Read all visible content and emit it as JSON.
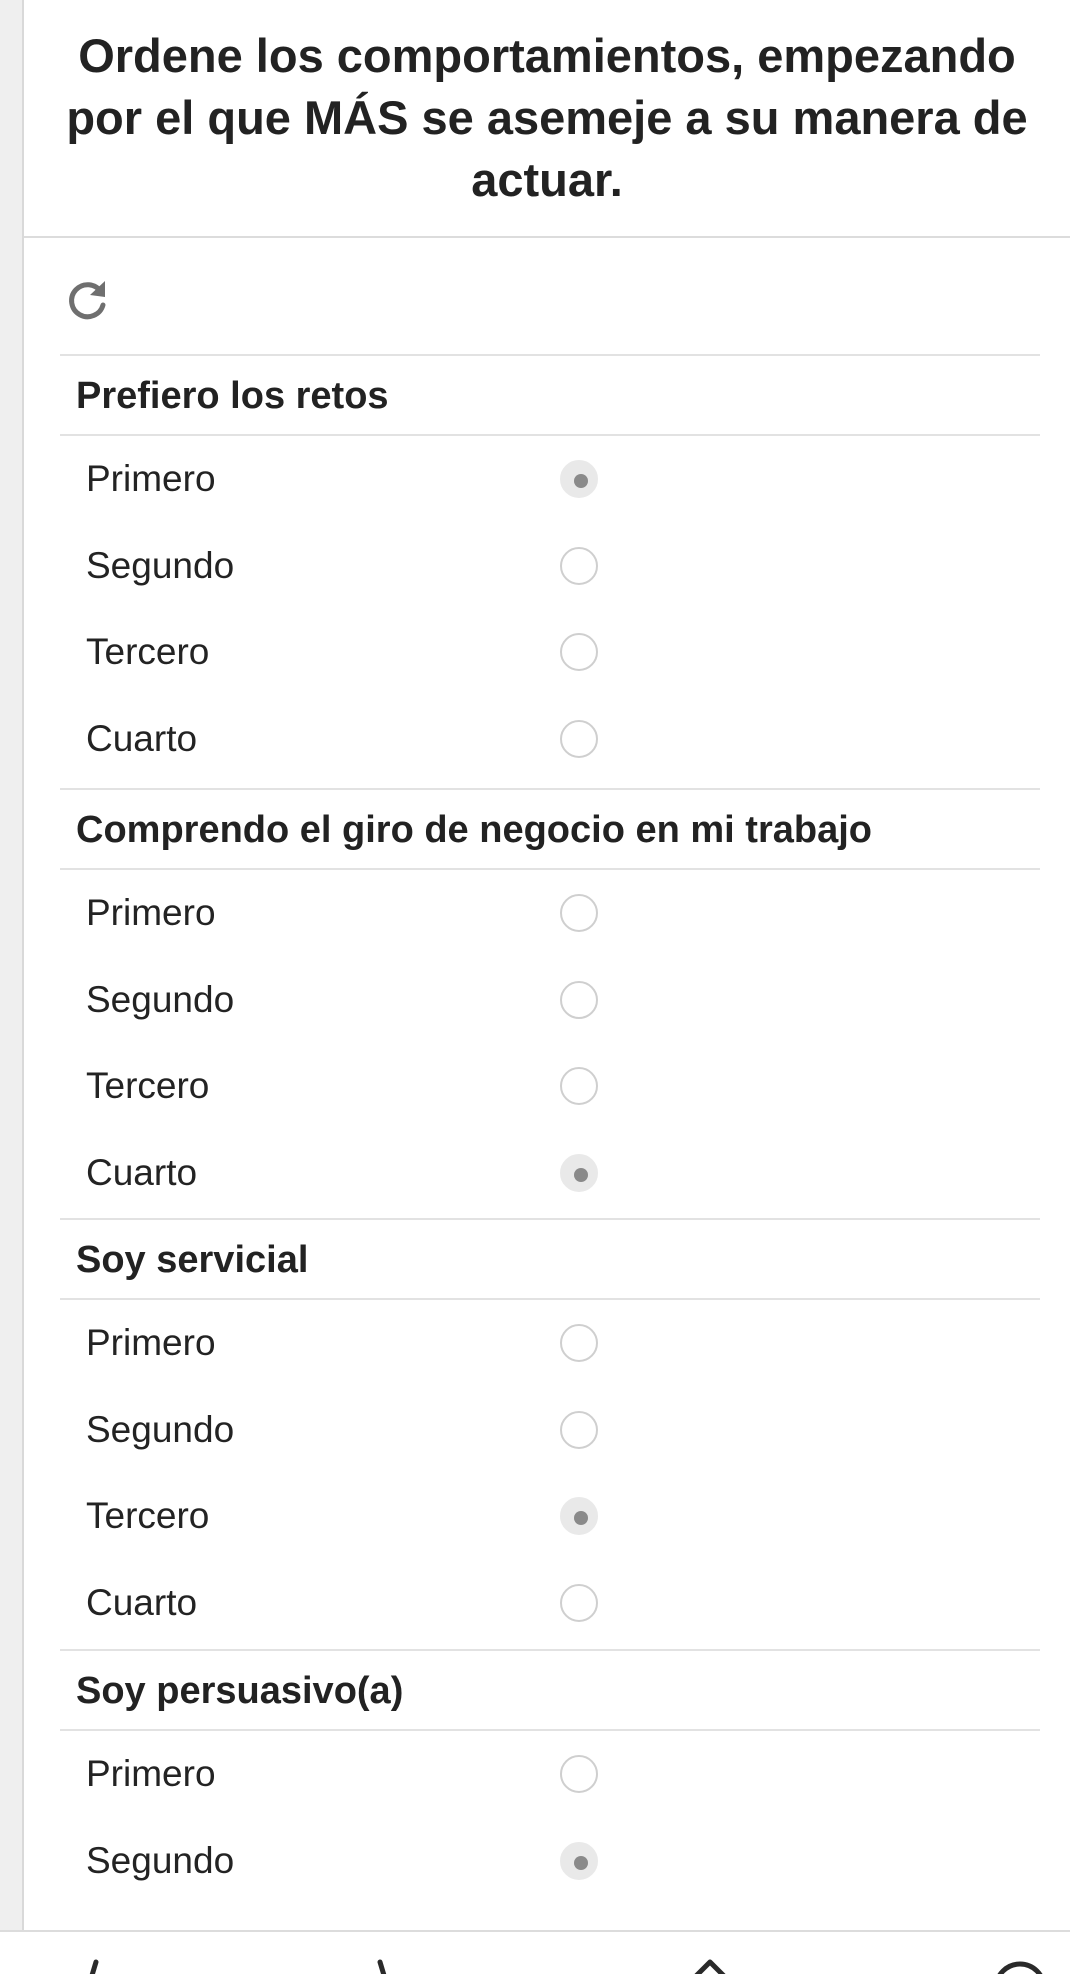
{
  "header": {
    "title": "Ordene los comportamientos, empezando por el que MÁS se asemeje a su manera de actuar."
  },
  "toolbar": {
    "refresh_icon": "refresh-icon"
  },
  "questions": [
    {
      "label": "Prefiero los retos",
      "options": [
        "Primero",
        "Segundo",
        "Tercero",
        "Cuarto"
      ],
      "selected": "Primero"
    },
    {
      "label": "Comprendo el giro de negocio en mi trabajo",
      "options": [
        "Primero",
        "Segundo",
        "Tercero",
        "Cuarto"
      ],
      "selected": "Cuarto"
    },
    {
      "label": "Soy servicial",
      "options": [
        "Primero",
        "Segundo",
        "Tercero",
        "Cuarto"
      ],
      "selected": "Tercero"
    },
    {
      "label": "Soy persuasivo(a)",
      "options": [
        "Primero",
        "Segundo"
      ],
      "selected": "Segundo"
    }
  ],
  "nav_icons": [
    "back-icon",
    "forward-icon",
    "up-icon",
    "circle-icon"
  ],
  "colors": {
    "radio_border": "#cfcfcf",
    "radio_checked_bg": "#e9e9e9",
    "radio_dot": "#8a8a8a",
    "divider": "#e2e2e2"
  }
}
